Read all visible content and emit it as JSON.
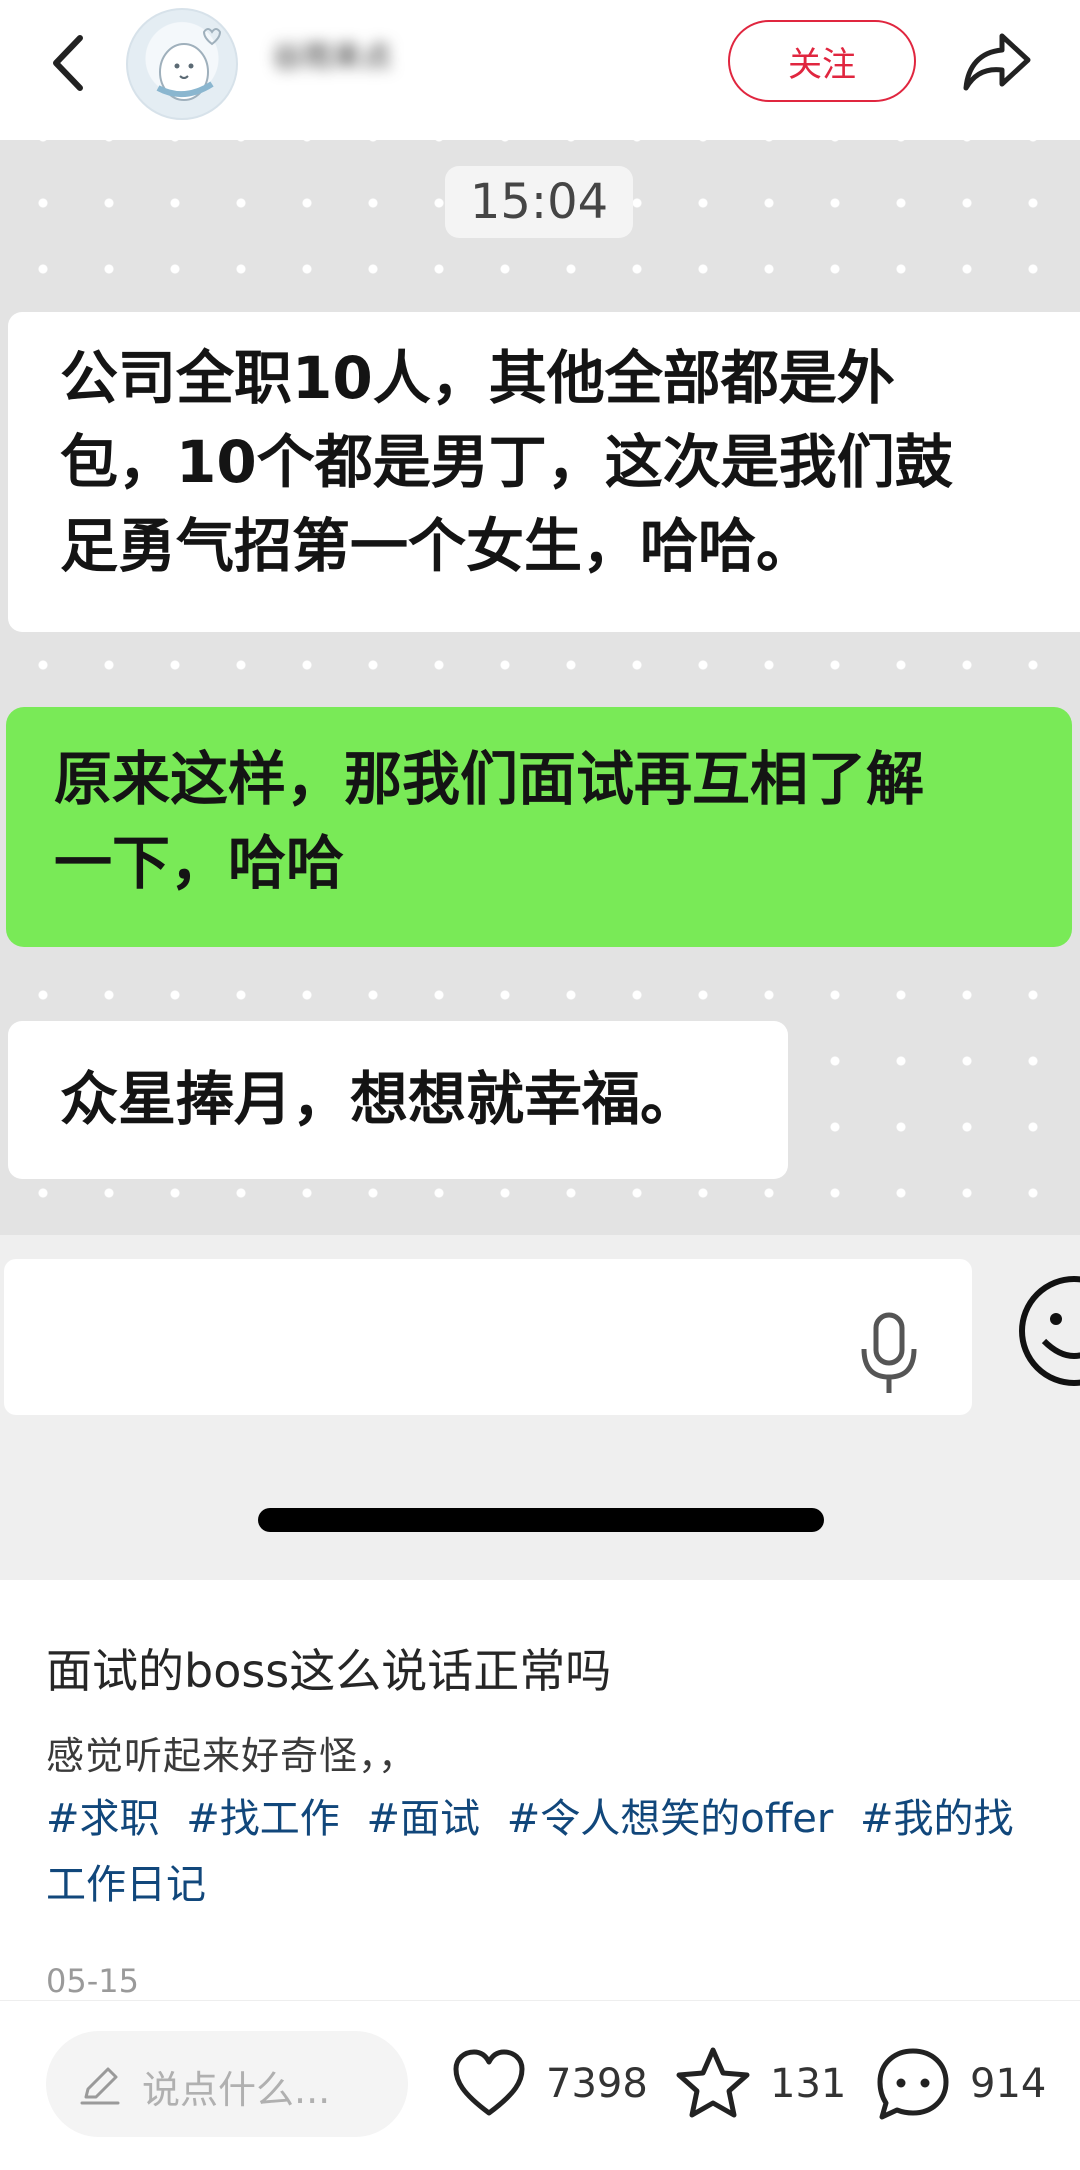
{
  "header": {
    "author_name": "谷雨来点",
    "follow_label": "关注"
  },
  "chat": {
    "time": "15:04",
    "messages": [
      {
        "side": "left",
        "text_lines": [
          "公司全职10人，其他全部都是外",
          "包，10个都是男丁，这次是我们鼓",
          "足勇气招第一个女生，哈哈。"
        ]
      },
      {
        "side": "right",
        "text_lines": [
          "原来这样，那我们面试再互相了解",
          "一下，哈哈"
        ]
      },
      {
        "side": "left",
        "text_lines": [
          "众星捧月，想想就幸福。"
        ]
      }
    ]
  },
  "note": {
    "title": "面试的boss这么说话正常吗",
    "desc": "感觉听起来好奇怪，，",
    "tags": [
      "#求职",
      "#找工作",
      "#面试",
      "#令人想笑的offer",
      "#我的找工作日记"
    ],
    "date": "05-15"
  },
  "bottom": {
    "comment_placeholder": "说点什么...",
    "likes": "7398",
    "collects": "131",
    "comments": "914"
  },
  "colors": {
    "accent": "#e0263f",
    "tag": "#11477b",
    "bubble_green": "#79ea57"
  },
  "icons": [
    "back-arrow-icon",
    "share-icon",
    "mic-icon",
    "emoji-icon",
    "pencil-icon",
    "heart-icon",
    "star-icon",
    "comment-icon"
  ]
}
